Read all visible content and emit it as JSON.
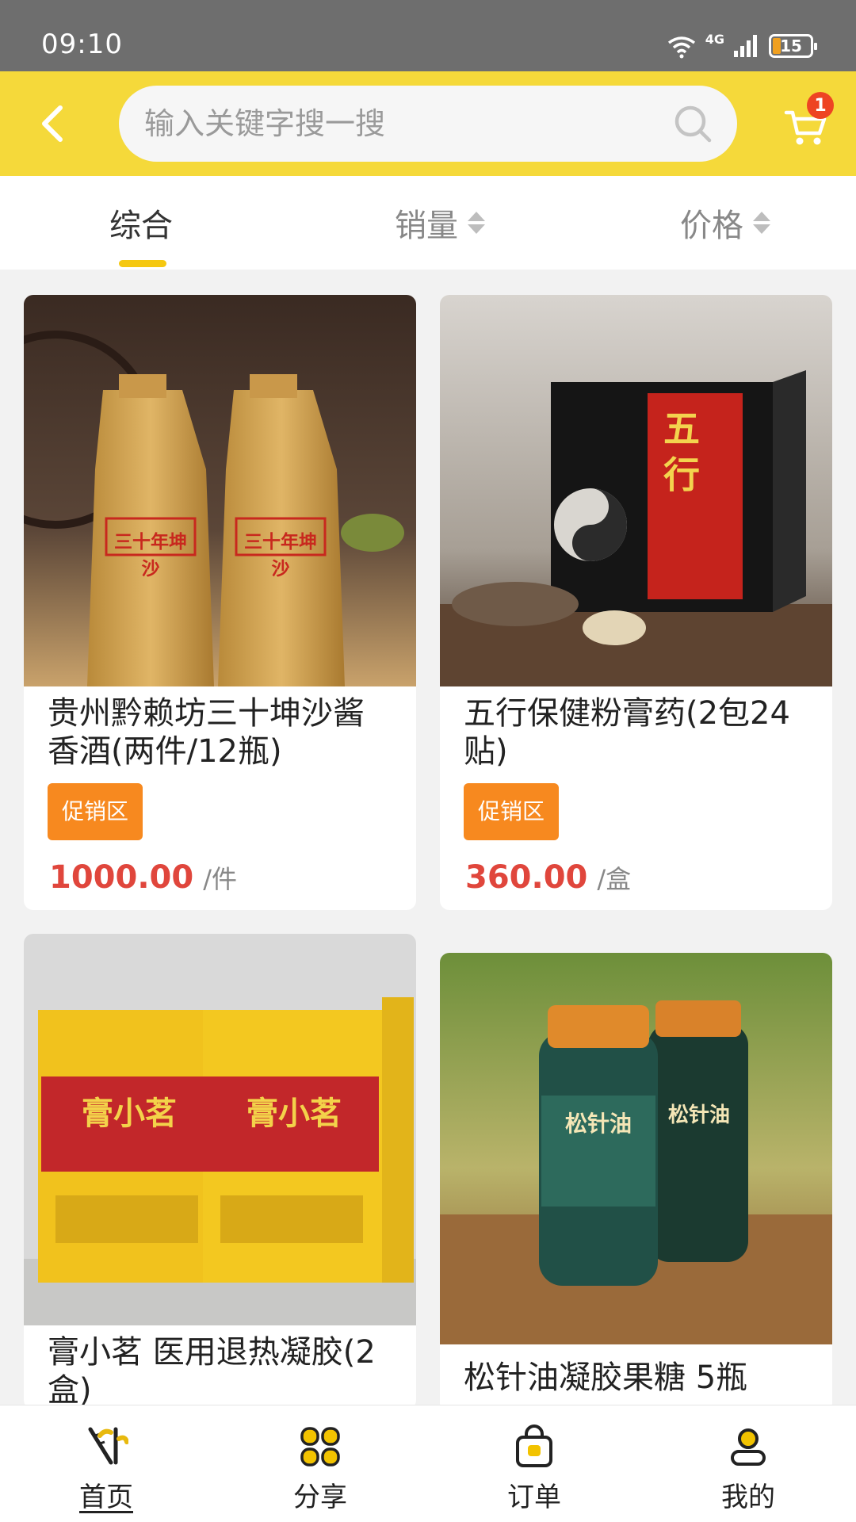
{
  "status": {
    "time": "09:10",
    "battery": "15",
    "network": "4G"
  },
  "search": {
    "placeholder": "输入关键字搜一搜"
  },
  "cart": {
    "badge": "1"
  },
  "sort_tabs": [
    {
      "label": "综合",
      "active": true
    },
    {
      "label": "销量"
    },
    {
      "label": "价格"
    }
  ],
  "products": [
    {
      "title": "贵州黔赖坊三十坤沙酱香酒(两件/12瓶)",
      "tag": "促销区",
      "price": "1000.00",
      "unit": "/件",
      "img_text": "三十年坤沙"
    },
    {
      "title": "五行保健粉膏药(2包24贴)",
      "tag": "促销区",
      "price": "360.00",
      "unit": "/盒",
      "img_text": "五行"
    },
    {
      "title": "膏小茗 医用退热凝胶(2盒)",
      "img_text": "膏小茗"
    },
    {
      "title": "松针油凝胶果糖 5瓶",
      "img_text": "松针油"
    }
  ],
  "nav": [
    {
      "label": "首页",
      "icon": "bamboo-home-icon",
      "active": true
    },
    {
      "label": "分享",
      "icon": "share-grid-icon"
    },
    {
      "label": "订单",
      "icon": "order-bag-icon"
    },
    {
      "label": "我的",
      "icon": "user-icon"
    }
  ],
  "colors": {
    "header": "#f5d93a",
    "price": "#e0463c",
    "promo": "#f7891f",
    "badge": "#ee4423"
  }
}
